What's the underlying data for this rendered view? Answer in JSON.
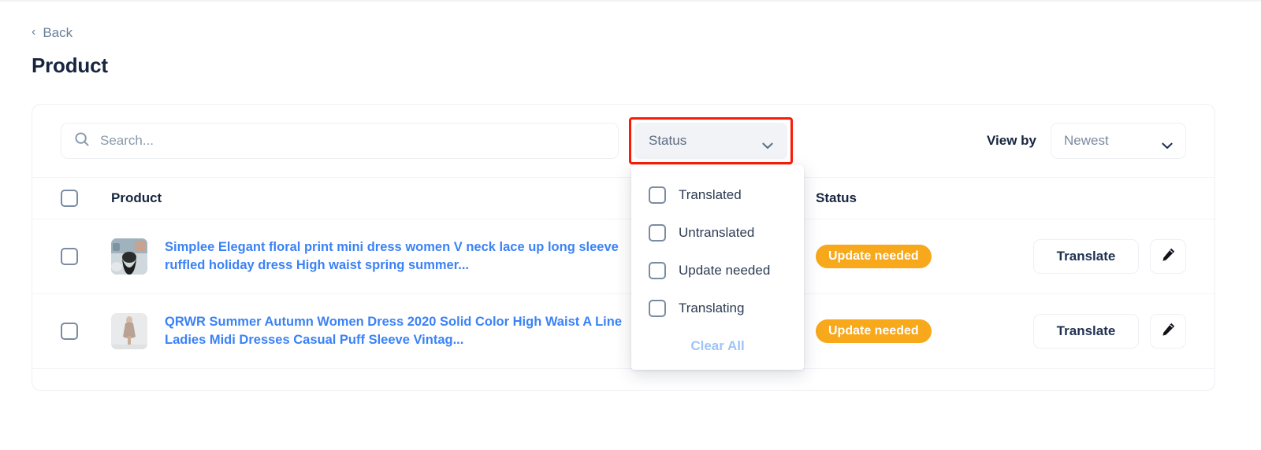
{
  "header": {
    "back_label": "Back",
    "back_icon": "chevron-left-icon",
    "title": "Product"
  },
  "toolbar": {
    "search": {
      "icon": "search-icon",
      "placeholder": "Search...",
      "value": ""
    },
    "status_filter": {
      "label": "Status",
      "icon": "chevron-down-icon",
      "highlight_color": "#fb1b07",
      "expanded": true
    },
    "view_by": {
      "label": "View by",
      "selected": "Newest",
      "icon": "chevron-down-icon"
    }
  },
  "status_dropdown": {
    "options": [
      {
        "label": "Translated",
        "checked": false
      },
      {
        "label": "Untranslated",
        "checked": false
      },
      {
        "label": "Update needed",
        "checked": false
      },
      {
        "label": "Translating",
        "checked": false
      }
    ],
    "clear_all_label": "Clear All"
  },
  "table": {
    "columns": {
      "select_all": "",
      "product": "Product",
      "status": "Status",
      "actions": ""
    },
    "rows": [
      {
        "selected": false,
        "thumbnail": "product-thumbnail-floral-dress",
        "title": "Simplee Elegant floral print mini dress women V neck lace up long sleeve ruffled holiday dress High waist spring summer...",
        "status": "Update needed",
        "status_color": "#f7a81b",
        "translate_label": "Translate",
        "edit_icon": "pencil-icon"
      },
      {
        "selected": false,
        "thumbnail": "product-thumbnail-midi-dress",
        "title": "QRWR Summer Autumn Women Dress 2020 Solid Color High Waist A Line Ladies Midi Dresses Casual Puff Sleeve Vintag...",
        "status": "Update needed",
        "status_color": "#f7a81b",
        "translate_label": "Translate",
        "edit_icon": "pencil-icon"
      }
    ]
  }
}
